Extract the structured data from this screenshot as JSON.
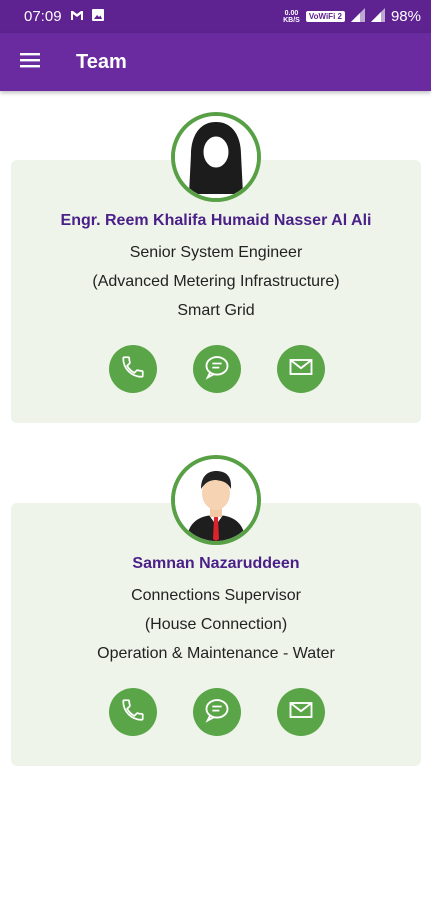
{
  "status_bar": {
    "time": "07:09",
    "speed_top": "0.00",
    "speed_bottom": "KB/S",
    "vowifi": "VoWiFi 2",
    "battery": "98%"
  },
  "app_bar": {
    "title": "Team"
  },
  "team": [
    {
      "name": "Engr. Reem Khalifa Humaid Nasser Al Ali",
      "title": "Senior System Engineer",
      "subtitle": "(Advanced Metering Infrastructure)",
      "department": "Smart Grid"
    },
    {
      "name": "Samnan Nazaruddeen",
      "title": "Connections Supervisor",
      "subtitle": "(House Connection)",
      "department": "Operation & Maintenance - Water"
    }
  ],
  "colors": {
    "status_bar": "#5e2390",
    "app_bar": "#6a2aa0",
    "accent_green": "#5aa548",
    "name_purple": "#4a1f88",
    "card_bg": "#eef4ea"
  },
  "icons": [
    "menu-icon",
    "phone-icon",
    "chat-icon",
    "mail-icon"
  ]
}
